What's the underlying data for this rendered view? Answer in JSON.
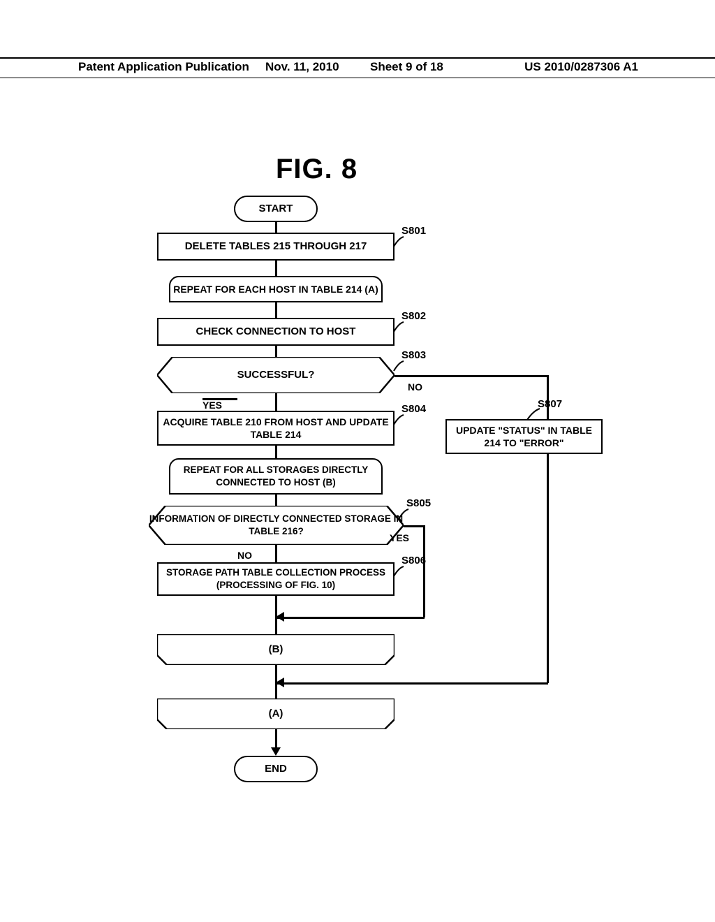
{
  "header": {
    "left": "Patent Application Publication",
    "date": "Nov. 11, 2010",
    "sheet": "Sheet 9 of 18",
    "pubnum": "US 2010/0287306 A1"
  },
  "figure": {
    "title": "FIG. 8"
  },
  "refs": {
    "s801": "S801",
    "s802": "S802",
    "s803": "S803",
    "s804": "S804",
    "s805": "S805",
    "s806": "S806",
    "s807": "S807"
  },
  "nodes": {
    "start": "START",
    "end": "END",
    "n801": "DELETE TABLES 215 THROUGH 217",
    "loopA_start": "REPEAT FOR EACH HOST IN TABLE 214 (A)",
    "n802": "CHECK CONNECTION TO HOST",
    "n803": "SUCCESSFUL?",
    "n804": "ACQUIRE TABLE 210 FROM HOST AND UPDATE TABLE 214",
    "loopB_start": "REPEAT FOR ALL STORAGES DIRECTLY CONNECTED TO HOST (B)",
    "n805": "INFORMATION OF DIRECTLY CONNECTED STORAGE IN TABLE 216?",
    "n806": "STORAGE PATH TABLE COLLECTION PROCESS (PROCESSING OF FIG. 10)",
    "loopB_end": "(B)",
    "loopA_end": "(A)",
    "n807": "UPDATE \"STATUS\" IN TABLE 214 TO \"ERROR\""
  },
  "branches": {
    "yes": "YES",
    "no": "NO"
  }
}
